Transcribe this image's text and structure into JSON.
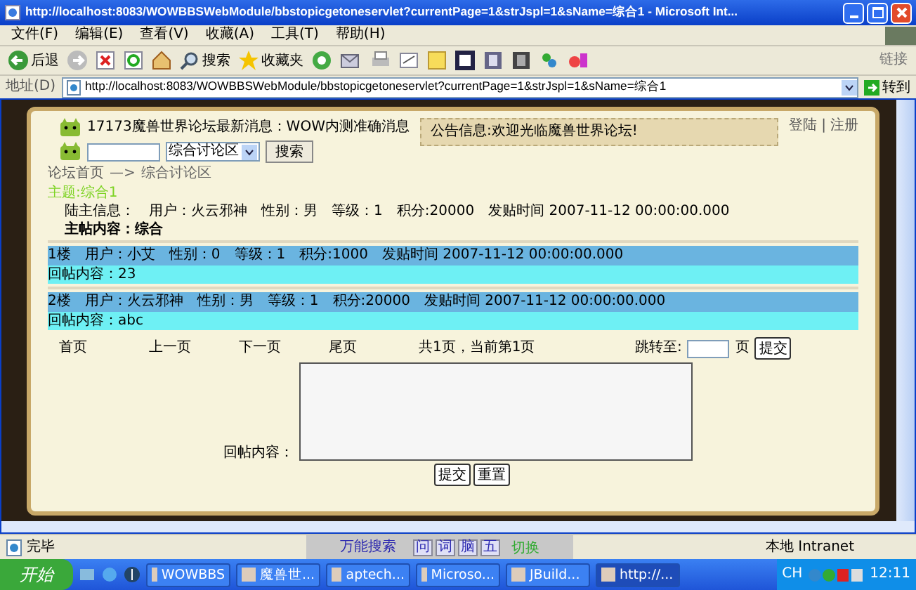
{
  "window": {
    "title": "http://localhost:8083/WOWBBSWebModule/bbstopicgetoneservlet?currentPage=1&strJspl=1&sName=综合1 - Microsoft Int..."
  },
  "menu": [
    "文件(F)",
    "编辑(E)",
    "查看(V)",
    "收藏(A)",
    "工具(T)",
    "帮助(H)"
  ],
  "toolbar": {
    "back": "后退",
    "search": "搜索",
    "favorites": "收藏夹",
    "links": "链接"
  },
  "address": {
    "label": "地址(D)",
    "url": "http://localhost:8083/WOWBBSWebModule/bbstopicgetoneservlet?currentPage=1&strJspl=1&sName=综合1",
    "go": "转到"
  },
  "page": {
    "news": "17173魔兽世界论坛最新消息：WOW内测准确消息",
    "forum_select": "综合讨论区",
    "search_button": "搜索",
    "notice": "公告信息:欢迎光临魔兽世界论坛!",
    "auth_links": [
      "登陆",
      "注册"
    ],
    "auth_separator": "|",
    "breadcrumb": [
      "论坛首页",
      "—>",
      "综合讨论区"
    ],
    "topic": "主题:综合1",
    "host": {
      "label": "陆主信息：",
      "fields": [
        "用户：火云邪神",
        "性别：男",
        "等级：1",
        "积分:20000",
        "发贴时间  2007-11-12 00:00:00.000"
      ],
      "content": "主帖内容：综合"
    },
    "replies": [
      {
        "floor": "1楼",
        "fields": [
          "用户：小艾",
          "性别：0",
          "等级：1",
          "积分:1000",
          "发贴时间  2007-11-12 00:00:00.000"
        ],
        "content": "回帖内容：23"
      },
      {
        "floor": "2楼",
        "fields": [
          "用户：火云邪神",
          "性别：男",
          "等级：1",
          "积分:20000",
          "发贴时间  2007-11-12 00:00:00.000"
        ],
        "content": "回帖内容：abc"
      }
    ],
    "pagination": [
      "首页",
      "上一页",
      "下一页",
      "尾页",
      "共1页，当前第1页"
    ],
    "jump": {
      "label": "跳转至:",
      "unit": "页",
      "button": "提交"
    },
    "reply_form": {
      "label": "回帖内容：",
      "buttons": [
        "提交",
        "重置"
      ]
    }
  },
  "status_bar": {
    "text": "完毕",
    "zone": "本地 Intranet"
  },
  "ime": {
    "title": "万能搜索",
    "keys": [
      "问",
      "词",
      "脑",
      "五"
    ],
    "switch": "切换"
  },
  "taskbar": {
    "start": "开始",
    "tasks": [
      {
        "label": "WOWBBS",
        "selected": false
      },
      {
        "label": "魔兽世...",
        "selected": false
      },
      {
        "label": "aptech...",
        "selected": false
      },
      {
        "label": "Microso...",
        "selected": false
      },
      {
        "label": "JBuild...",
        "selected": false
      },
      {
        "label": "http://...",
        "selected": true
      }
    ],
    "lang": "CH",
    "clock": "12:11"
  }
}
